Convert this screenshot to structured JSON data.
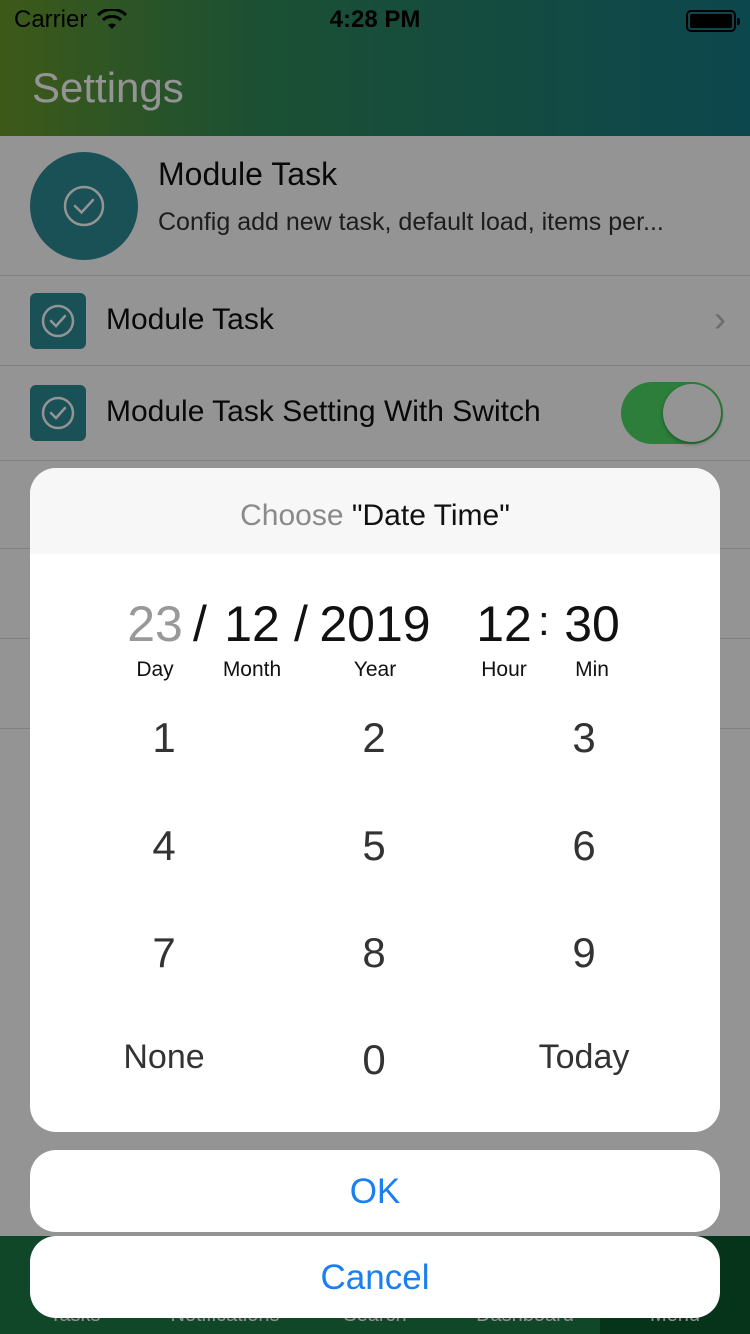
{
  "status": {
    "carrier": "Carrier",
    "time": "4:28 PM"
  },
  "header": {
    "title": "Settings"
  },
  "module": {
    "title": "Module Task",
    "description": "Config add new task, default load, items per..."
  },
  "rows": [
    {
      "label": "Module Task"
    },
    {
      "label": "Module Task Setting With Switch",
      "switch_on": true
    }
  ],
  "tabs": [
    "Tasks",
    "Notifications",
    "Search",
    "Dashboard",
    "Menu"
  ],
  "dialog": {
    "choose": "Choose",
    "field": "\"Date Time\"",
    "date": {
      "day": "23",
      "month": "12",
      "year": "2019",
      "hour": "12",
      "min": "30"
    },
    "labels": {
      "day": "Day",
      "month": "Month",
      "year": "Year",
      "hour": "Hour",
      "min": "Min"
    },
    "separators": {
      "date": "/",
      "time": ":"
    },
    "keys": [
      "1",
      "2",
      "3",
      "4",
      "5",
      "6",
      "7",
      "8",
      "9",
      "None",
      "0",
      "Today"
    ]
  },
  "buttons": {
    "ok": "OK",
    "cancel": "Cancel"
  },
  "colors": {
    "accent": "#2c8c97",
    "link": "#1a7ff0",
    "switch_on": "#4cd964"
  }
}
